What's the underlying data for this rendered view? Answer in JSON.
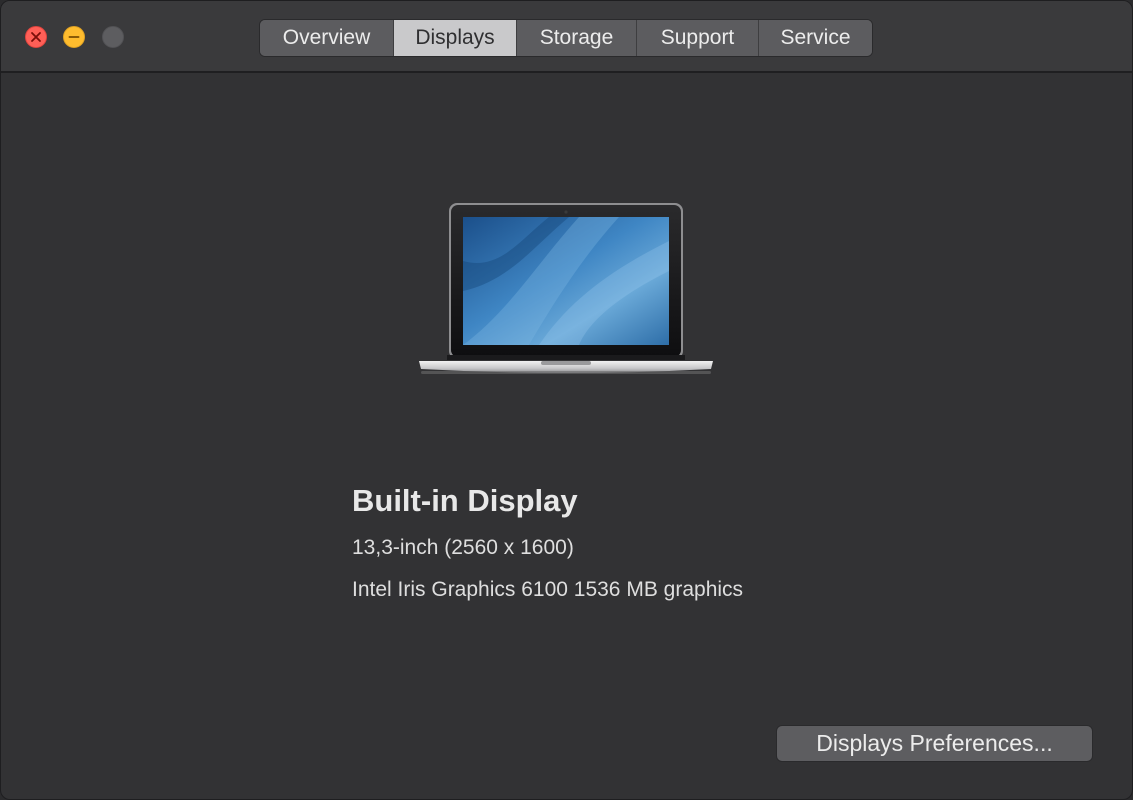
{
  "window": {
    "controls": [
      "close",
      "minimize",
      "zoom"
    ]
  },
  "tabs": [
    {
      "label": "Overview",
      "active": false
    },
    {
      "label": "Displays",
      "active": true
    },
    {
      "label": "Storage",
      "active": false
    },
    {
      "label": "Support",
      "active": false
    },
    {
      "label": "Service",
      "active": false
    }
  ],
  "display": {
    "icon": "macbook-pro-icon",
    "title": "Built-in Display",
    "size": "13,3-inch (2560 x 1600)",
    "graphics": "Intel Iris Graphics 6100 1536 MB graphics"
  },
  "buttons": {
    "preferences": "Displays Preferences..."
  },
  "colors": {
    "background": "#323234",
    "titlebar": "#3a3a3c",
    "close": "#ff5f57",
    "minimize": "#febc2e",
    "zoom_disabled": "#5d5d60",
    "active_tab": "#c9c9cb"
  }
}
